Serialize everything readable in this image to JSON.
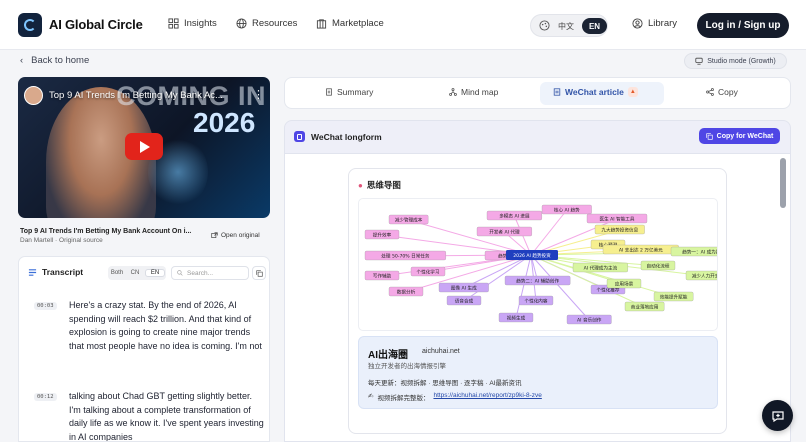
{
  "header": {
    "brand": "AI Global Circle",
    "nav": [
      {
        "label": "Insights",
        "icon": "grid-icon"
      },
      {
        "label": "Resources",
        "icon": "globe-icon"
      },
      {
        "label": "Marketplace",
        "icon": "store-icon"
      }
    ],
    "lang_zh": "中文",
    "lang_en": "EN",
    "library": "Library",
    "login": "Log in / Sign up"
  },
  "back_label": "Back to home",
  "studio_mode": "Studio mode (Growth)",
  "video": {
    "overlay_title": "Top 9 AI Trends I'm Betting My Bank Ac...",
    "overlay_big_1": "COMING IN",
    "overlay_big_2": "2026",
    "caption": "Top 9 AI Trends I'm Betting My Bank Account On i...",
    "source": "Dan Martell · Original source",
    "open_original": "Open original"
  },
  "transcript": {
    "title": "Transcript",
    "modes": [
      "Both",
      "CN",
      "EN"
    ],
    "active_mode": "EN",
    "search_placeholder": "Search...",
    "lines": [
      {
        "time": "00:03",
        "text": "Here's a crazy stat. By the end of 2026, AI spending will reach $2 trillion. And that kind of explosion is going to create nine major trends that most people have no idea is coming. I'm not"
      },
      {
        "time": "00:12",
        "text": "talking about Chad GBT getting slightly better. I'm talking about a complete transformation of daily life as we know it. I've spent years investing in AI companies"
      }
    ]
  },
  "tabs": [
    {
      "label": "Summary",
      "icon": "document-icon"
    },
    {
      "label": "Mind map",
      "icon": "mindmap-icon"
    },
    {
      "label": "WeChat article",
      "icon": "article-icon",
      "active": true,
      "badge": "flame-icon"
    },
    {
      "label": "Copy",
      "icon": "share-icon"
    }
  ],
  "article": {
    "title": "WeChat longform",
    "copy_button": "Copy for WeChat",
    "mindmap_heading": "思维导图",
    "mindmap": {
      "center": "2026 AI 趋势投资",
      "nodes": [
        {
          "text": "核心 AI 趋势",
          "color": "#f4a9e6"
        },
        {
          "text": "医生 AI 智能工具",
          "color": "#f4a9e6"
        },
        {
          "text": "多模态 AI 进展",
          "color": "#f4a9e6"
        },
        {
          "text": "开发者 AI 代理",
          "color": "#f4a9e6"
        },
        {
          "text": "减少管理成本",
          "color": "#f4a9e6"
        },
        {
          "text": "提升效率",
          "color": "#f4a9e6"
        },
        {
          "text": "趋势三：个人 AI 助手",
          "color": "#f4a9e6"
        },
        {
          "text": "处理 50-70% 日常任务",
          "color": "#f4a9e6"
        },
        {
          "text": "个性化学习",
          "color": "#f4a9e6"
        },
        {
          "text": "写作辅助",
          "color": "#f4a9e6"
        },
        {
          "text": "数据分析",
          "color": "#f4a9e6"
        },
        {
          "text": "趋势二：AI 辅助创作",
          "color": "#c9a6f5"
        },
        {
          "text": "个性化内容",
          "color": "#c9a6f5"
        },
        {
          "text": "视频生成",
          "color": "#c9a6f5"
        },
        {
          "text": "语音合成",
          "color": "#c9a6f5"
        },
        {
          "text": "图像 AI 生成",
          "color": "#c9a6f5"
        },
        {
          "text": "个性化推荐",
          "color": "#c9a6f5"
        },
        {
          "text": "AI 音乐创作",
          "color": "#c9a6f5"
        },
        {
          "text": "九大趋势投资信息",
          "color": "#f6ef8f"
        },
        {
          "text": "核心预测",
          "color": "#f6ef8f"
        },
        {
          "text": "AI 支出达 2 万亿美元",
          "color": "#f6ef8f"
        },
        {
          "text": "AI 代理成为主流",
          "color": "#d8f5a0"
        },
        {
          "text": "趋势一：AI 成为助手",
          "color": "#d8f5a0"
        },
        {
          "text": "自动化流程",
          "color": "#d8f5a0"
        },
        {
          "text": "减少人力开支",
          "color": "#d8f5a0"
        },
        {
          "text": "应用场景",
          "color": "#d8f5a0"
        },
        {
          "text": "商业落地应用",
          "color": "#d8f5a0"
        },
        {
          "text": "效能提升赋能",
          "color": "#d8f5a0"
        }
      ]
    },
    "promo": {
      "title": "AI出海圈",
      "domain": "aichuhai.net",
      "subtitle": "独立开发者的出海情报引擎",
      "daily": "每天更新：视频拆解 · 思维导图 · 逐字稿 · AI最新资讯",
      "link_prefix": "视频拆解完整版：",
      "link": "https://aichuhai.net/report/zp9ki-8-zve"
    }
  }
}
